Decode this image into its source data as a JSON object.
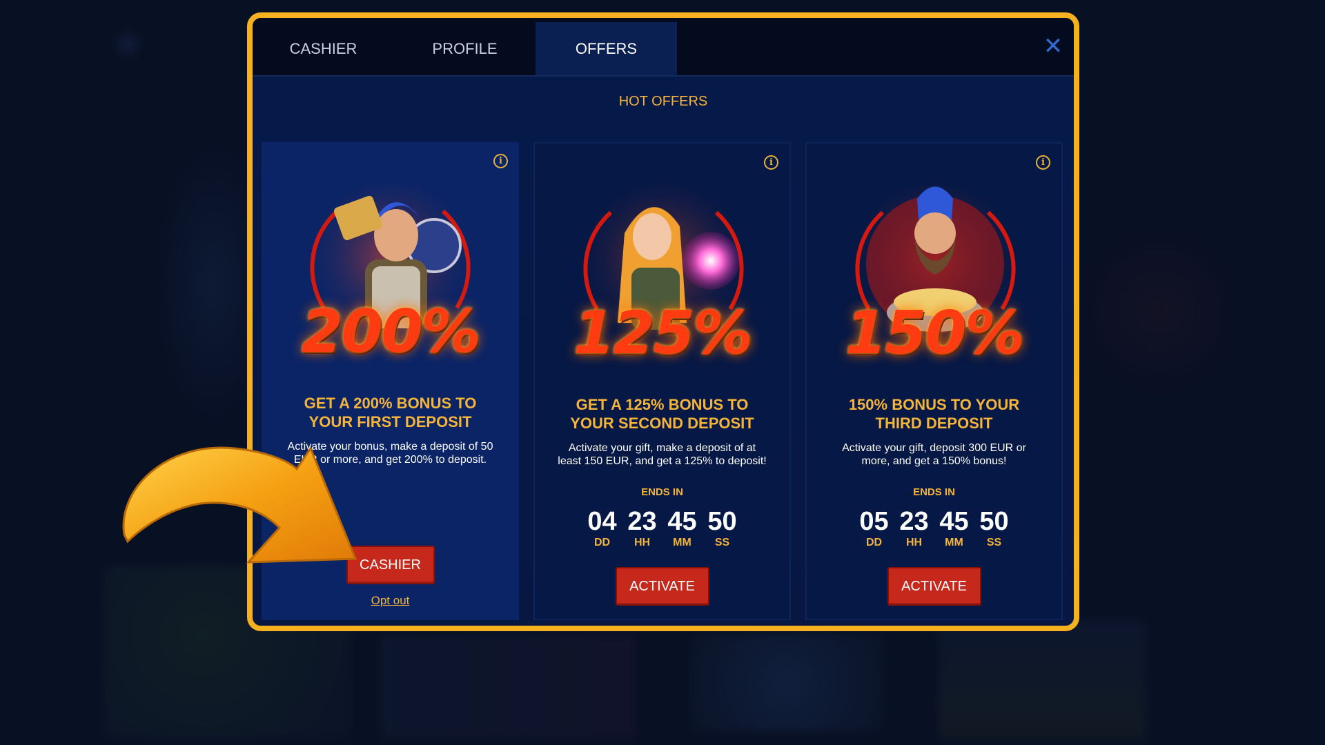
{
  "tabs": [
    {
      "label": "CASHIER"
    },
    {
      "label": "PROFILE"
    },
    {
      "label": "OFFERS"
    }
  ],
  "active_tab": "OFFERS",
  "section_title": "HOT OFFERS",
  "colors": {
    "accent": "#f5b43a",
    "frame": "#f5b120",
    "button": "#c7281c",
    "close": "#2f6ad9"
  },
  "offers": [
    {
      "percent": "200%",
      "title": "GET A 200% BONUS TO\nYOUR FIRST DEPOSIT",
      "description": "Activate your bonus, make a deposit of 50 EUR or more, and get 200% to deposit.",
      "button": "CASHIER",
      "link": "Opt out"
    },
    {
      "percent": "125%",
      "title": "GET A 125% BONUS TO\nYOUR SECOND DEPOSIT",
      "description": "Activate your gift, make a deposit of at least 150 EUR, and get a 125% to deposit!",
      "ends_label": "ENDS IN",
      "timer": {
        "dd": "04",
        "hh": "23",
        "mm": "45",
        "ss": "50"
      },
      "timer_labels": {
        "dd": "DD",
        "hh": "HH",
        "mm": "MM",
        "ss": "SS"
      },
      "button": "ACTIVATE"
    },
    {
      "percent": "150%",
      "title": "150% BONUS TO YOUR\nTHIRD DEPOSIT",
      "description": "Activate your gift, deposit 300 EUR or more, and get a 150% bonus!",
      "ends_label": "ENDS IN",
      "timer": {
        "dd": "05",
        "hh": "23",
        "mm": "45",
        "ss": "50"
      },
      "timer_labels": {
        "dd": "DD",
        "hh": "HH",
        "mm": "MM",
        "ss": "SS"
      },
      "button": "ACTIVATE"
    }
  ],
  "icons": {
    "close": "close-icon",
    "info": "info-icon",
    "pointer": "arrow-pointer-icon"
  }
}
